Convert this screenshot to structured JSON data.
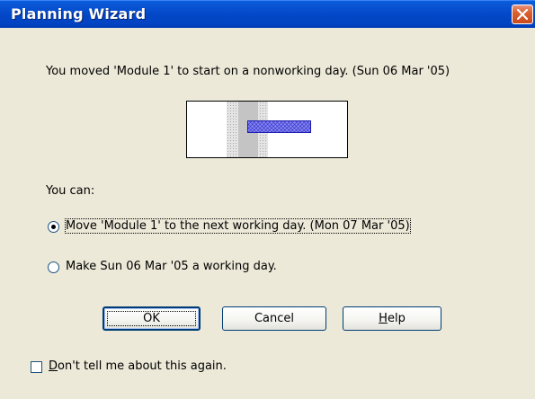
{
  "window": {
    "title": "Planning Wizard",
    "close_icon": "close-x-icon"
  },
  "message": "You moved 'Module 1' to start on a nonworking day.  (Sun 06 Mar '05)",
  "you_can_label": "You can:",
  "options": [
    {
      "label": "Move 'Module 1' to the next working day.  (Mon 07 Mar '05)",
      "selected": true
    },
    {
      "label": "Make Sun 06 Mar '05 a working day.",
      "selected": false
    }
  ],
  "buttons": {
    "ok": "OK",
    "cancel": "Cancel",
    "help_mnemonic": "H",
    "help_rest": "elp"
  },
  "checkbox": {
    "mnemonic": "D",
    "rest": "on't tell me about this again.",
    "checked": false
  },
  "colors": {
    "titlebar": "#0a5edc",
    "dialog_bg": "#ece9d8",
    "task_bar": "#8a8af0",
    "close_button": "#d9602f"
  }
}
